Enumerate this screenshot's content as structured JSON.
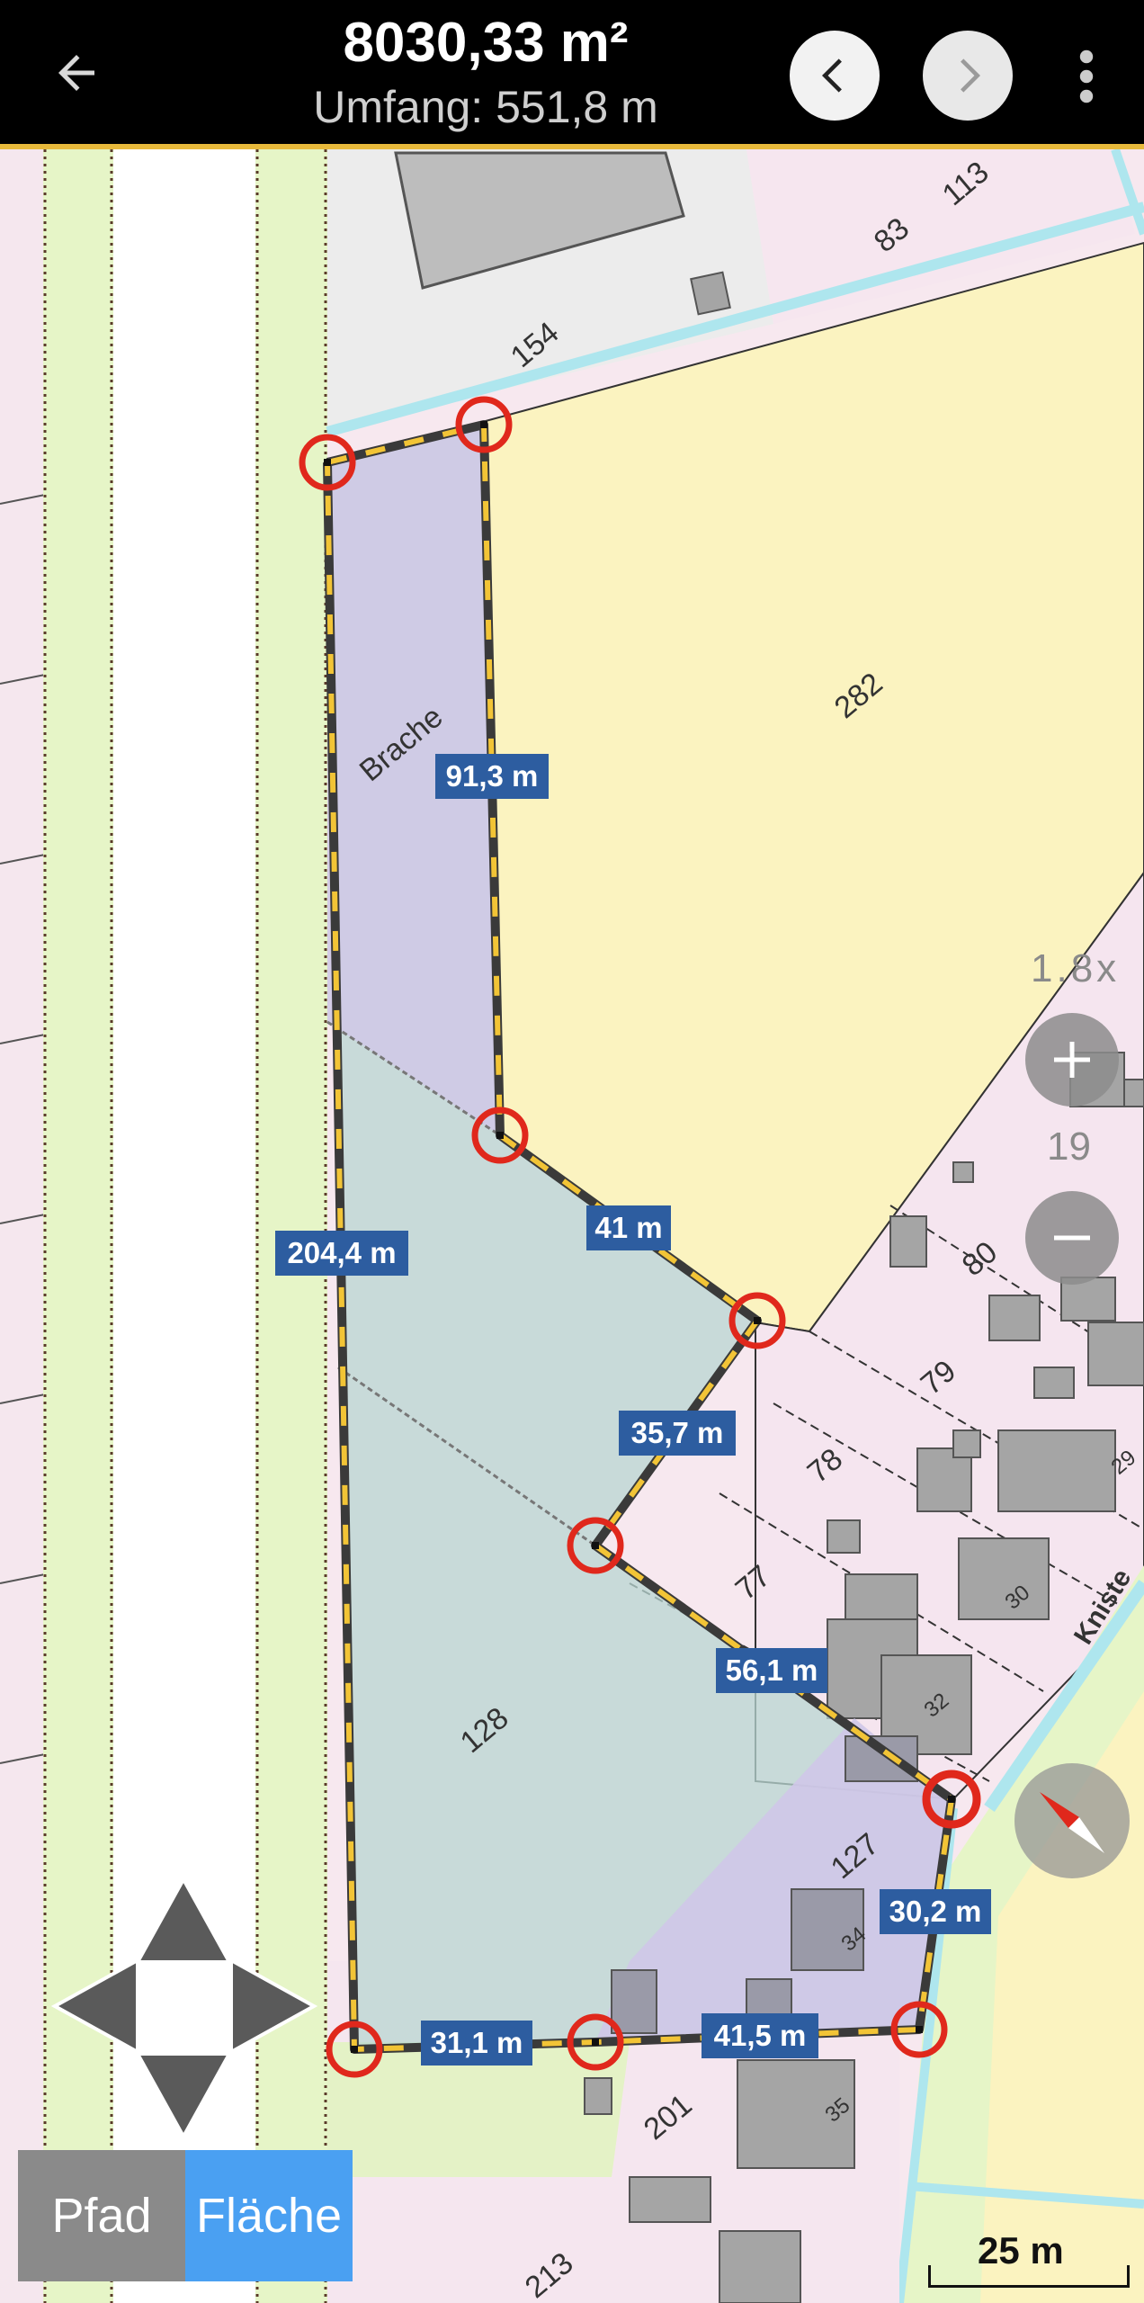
{
  "header": {
    "back_icon": "arrow-left-icon",
    "area": "8030,33 m²",
    "perimeter": "Umfang: 551,8 m",
    "prev_icon": "chevron-left-icon",
    "next_icon": "chevron-right-icon",
    "menu_icon": "more-vert-icon"
  },
  "map": {
    "parcel_numbers": [
      "113",
      "83",
      "154",
      "282",
      "80",
      "79",
      "78",
      "77",
      "30",
      "32",
      "127",
      "34",
      "128",
      "201",
      "35",
      "213",
      "29"
    ],
    "land_use_label": "Brache",
    "street_name": "Kniste",
    "segment_labels": [
      "91,3 m",
      "41 m",
      "35,7 m",
      "56,1 m",
      "30,2 m",
      "41,5 m",
      "31,1 m",
      "204,4 m"
    ],
    "colors": {
      "polygon_fill": "#9fc6d0",
      "polygon_fill_upper": "#c7c6e9",
      "outline_dash": "#f2c436",
      "outline_dark": "#3a3a3a",
      "vertex_ring": "#e0281c",
      "label_bg": "#2d5da0"
    }
  },
  "zoom": {
    "factor": "1.8x",
    "level": "19",
    "in_icon": "plus-icon",
    "out_icon": "minus-icon"
  },
  "compass_icon": "compass-icon",
  "dpad_icons": [
    "arrow-up-icon",
    "arrow-left-icon",
    "arrow-right-icon",
    "arrow-down-icon"
  ],
  "mode": {
    "path": "Pfad",
    "area": "Fläche",
    "selected": "Fläche"
  },
  "scale": {
    "label": "25 m"
  }
}
